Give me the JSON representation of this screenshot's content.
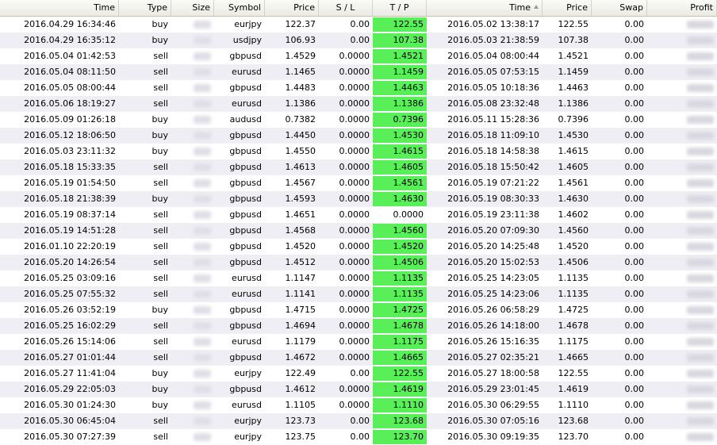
{
  "columns": [
    "Time",
    "Type",
    "Size",
    "Symbol",
    "Price",
    "S / L",
    "T / P",
    "Time",
    "Price",
    "Swap",
    "Profit"
  ],
  "rows": [
    [
      "2016.04.29 16:34:46",
      "buy",
      "eurjpy",
      "122.37",
      "0.00",
      "122.55",
      "2016.05.02 13:38:17",
      "122.55",
      "0.00"
    ],
    [
      "2016.04.29 16:35:12",
      "buy",
      "usdjpy",
      "106.93",
      "0.00",
      "107.38",
      "2016.05.03 21:38:59",
      "107.38",
      "0.00"
    ],
    [
      "2016.05.04 01:42:53",
      "sell",
      "gbpusd",
      "1.4529",
      "0.0000",
      "1.4521",
      "2016.05.04 08:00:44",
      "1.4521",
      "0.00"
    ],
    [
      "2016.05.04 08:11:50",
      "sell",
      "eurusd",
      "1.1465",
      "0.0000",
      "1.1459",
      "2016.05.05 07:53:15",
      "1.1459",
      "0.00"
    ],
    [
      "2016.05.05 08:00:44",
      "sell",
      "gbpusd",
      "1.4483",
      "0.0000",
      "1.4463",
      "2016.05.05 10:18:36",
      "1.4463",
      "0.00"
    ],
    [
      "2016.05.06 18:19:27",
      "sell",
      "eurusd",
      "1.1386",
      "0.0000",
      "1.1386",
      "2016.05.08 23:32:48",
      "1.1386",
      "0.00"
    ],
    [
      "2016.05.09 01:26:18",
      "buy",
      "audusd",
      "0.7382",
      "0.0000",
      "0.7396",
      "2016.05.11 15:28:36",
      "0.7396",
      "0.00"
    ],
    [
      "2016.05.12 18:06:50",
      "buy",
      "gbpusd",
      "1.4450",
      "0.0000",
      "1.4530",
      "2016.05.18 11:09:10",
      "1.4530",
      "0.00"
    ],
    [
      "2016.05.03 23:11:32",
      "buy",
      "gbpusd",
      "1.4550",
      "0.0000",
      "1.4615",
      "2016.05.18 14:58:38",
      "1.4615",
      "0.00"
    ],
    [
      "2016.05.18 15:33:35",
      "sell",
      "gbpusd",
      "1.4613",
      "0.0000",
      "1.4605",
      "2016.05.18 15:50:42",
      "1.4605",
      "0.00"
    ],
    [
      "2016.05.19 01:54:50",
      "sell",
      "gbpusd",
      "1.4567",
      "0.0000",
      "1.4561",
      "2016.05.19 07:21:22",
      "1.4561",
      "0.00"
    ],
    [
      "2016.05.18 21:38:39",
      "buy",
      "gbpusd",
      "1.4593",
      "0.0000",
      "1.4630",
      "2016.05.19 08:30:33",
      "1.4630",
      "0.00"
    ],
    [
      "2016.05.19 08:37:14",
      "sell",
      "gbpusd",
      "1.4651",
      "0.0000",
      "0.0000",
      "2016.05.19 23:11:38",
      "1.4602",
      "0.00"
    ],
    [
      "2016.05.19 14:51:28",
      "sell",
      "gbpusd",
      "1.4568",
      "0.0000",
      "1.4560",
      "2016.05.20 07:09:30",
      "1.4560",
      "0.00"
    ],
    [
      "2016.01.10 22:20:19",
      "sell",
      "gbpusd",
      "1.4520",
      "0.0000",
      "1.4520",
      "2016.05.20 14:25:48",
      "1.4520",
      "0.00"
    ],
    [
      "2016.05.20 14:26:54",
      "sell",
      "gbpusd",
      "1.4512",
      "0.0000",
      "1.4506",
      "2016.05.20 15:02:53",
      "1.4506",
      "0.00"
    ],
    [
      "2016.05.25 03:09:16",
      "sell",
      "eurusd",
      "1.1147",
      "0.0000",
      "1.1135",
      "2016.05.25 14:23:05",
      "1.1135",
      "0.00"
    ],
    [
      "2016.05.25 07:55:32",
      "sell",
      "eurusd",
      "1.1141",
      "0.0000",
      "1.1135",
      "2016.05.25 14:23:06",
      "1.1135",
      "0.00"
    ],
    [
      "2016.05.26 03:52:19",
      "buy",
      "gbpusd",
      "1.4715",
      "0.0000",
      "1.4725",
      "2016.05.26 06:58:29",
      "1.4725",
      "0.00"
    ],
    [
      "2016.05.25 16:02:29",
      "sell",
      "gbpusd",
      "1.4694",
      "0.0000",
      "1.4678",
      "2016.05.26 14:18:00",
      "1.4678",
      "0.00"
    ],
    [
      "2016.05.26 15:14:06",
      "sell",
      "eurusd",
      "1.1179",
      "0.0000",
      "1.1175",
      "2016.05.26 15:16:35",
      "1.1175",
      "0.00"
    ],
    [
      "2016.05.27 01:01:44",
      "sell",
      "gbpusd",
      "1.4672",
      "0.0000",
      "1.4665",
      "2016.05.27 02:35:21",
      "1.4665",
      "0.00"
    ],
    [
      "2016.05.27 11:41:04",
      "buy",
      "eurjpy",
      "122.49",
      "0.00",
      "122.55",
      "2016.05.27 18:00:58",
      "122.55",
      "0.00"
    ],
    [
      "2016.05.29 22:05:03",
      "buy",
      "gbpusd",
      "1.4612",
      "0.0000",
      "1.4619",
      "2016.05.29 23:01:45",
      "1.4619",
      "0.00"
    ],
    [
      "2016.05.30 01:24:30",
      "buy",
      "eurusd",
      "1.1105",
      "0.0000",
      "1.1110",
      "2016.05.30 06:29:55",
      "1.1110",
      "0.00"
    ],
    [
      "2016.05.30 06:45:04",
      "sell",
      "eurjpy",
      "123.73",
      "0.00",
      "123.68",
      "2016.05.30 07:05:16",
      "123.68",
      "0.00"
    ],
    [
      "2016.05.30 07:27:39",
      "sell",
      "eurjpy",
      "123.75",
      "0.00",
      "123.70",
      "2016.05.30 09:19:35",
      "123.70",
      "0.00"
    ]
  ],
  "colors": {
    "tp_hit": "#58ef58",
    "alt_row": "#f0eef5",
    "header": "#ebeae3"
  }
}
